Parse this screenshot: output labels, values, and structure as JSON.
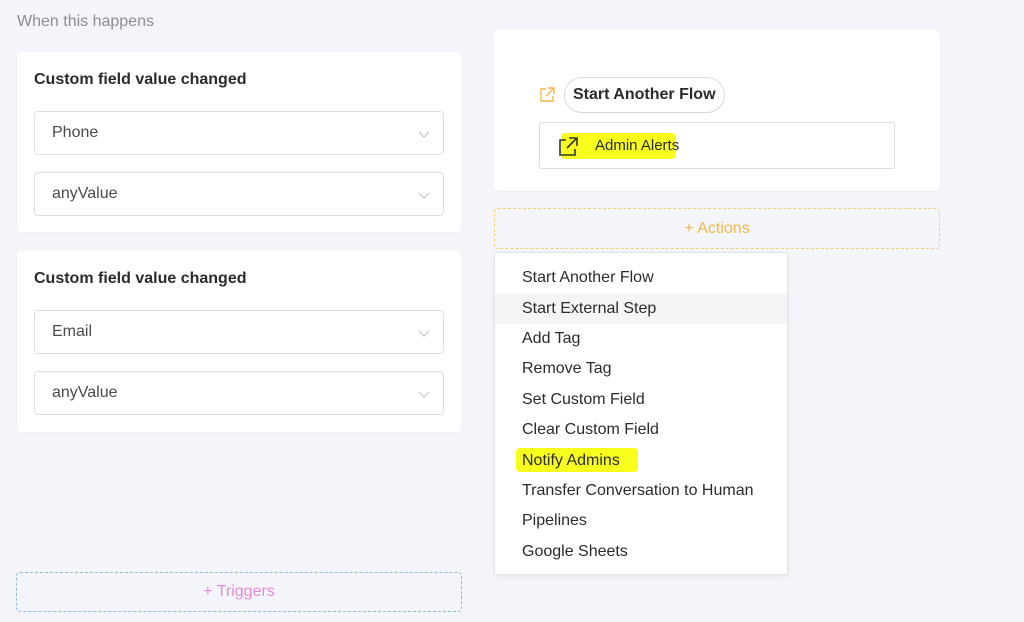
{
  "section_heading": "When this happens",
  "triggers": [
    {
      "title": "Custom field value changed",
      "field": "Phone",
      "value": "anyValue"
    },
    {
      "title": "Custom field value changed",
      "field": "Email",
      "value": "anyValue"
    }
  ],
  "triggers_button": "+ Triggers",
  "action": {
    "pill_label": "Start Another Flow",
    "flow_name": "Admin Alerts"
  },
  "actions_button": "+ Actions",
  "menu": {
    "items": [
      "Start Another Flow",
      "Start External Step",
      "Add Tag",
      "Remove Tag",
      "Set Custom Field",
      "Clear Custom Field",
      "Notify Admins",
      "Transfer Conversation to Human",
      "Pipelines",
      "Google Sheets"
    ],
    "hovered_item": "Start External Step",
    "highlighted_item": "Notify Admins"
  },
  "colors": {
    "background": "#f4f5fa",
    "highlight": "#f9ff1c",
    "external_icon_orange": "#f5b84a",
    "triggers_text": "#e58ad8",
    "actions_text": "#f2b84a"
  },
  "icons": [
    "chevron-down-icon",
    "external-link-icon"
  ]
}
